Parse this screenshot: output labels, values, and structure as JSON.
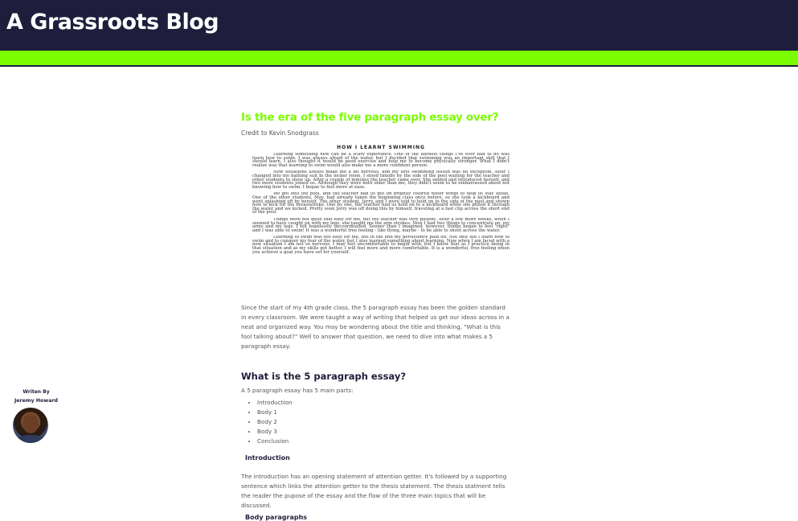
{
  "site": {
    "title": "A Grassroots Blog"
  },
  "colors": {
    "header_bg": "#1e1e3c",
    "accent": "#7cfc00",
    "text": "#555555"
  },
  "post": {
    "title": "Is the era of the five paragraph essay over?",
    "credit": "Credit to Kevin Snodgrass",
    "image": {
      "heading": "HOW I LEARNT SWIMMING",
      "paragraphs": [
        "Learning something new can be a scary experience. One of the hardest things I've ever had to do was learn how to swim. I was always afraid of the water, but I decided that swimming was an important skill that I should learn. I also thought it would be good exercise and help me to become physically stronger. What I didn't realize was that learning to swim would also make me a more confident person.",
        "New situations always make me a bit nervous, and my first swimming lesson was no exception. After I changed into my bathing suit in the locker room, I stood timidly by the side of the pool waiting for the teacher and other students to show up. After a couple of minutes the teacher came over. She smiled and introduced herself, and two more students joined us. Although they were both older than me, they didn't seem to be embarrassed about not knowing how to swim. I began to feel more at ease.",
        "We got into the pool, and the teacher had us put on brightly colored water wings to help us stay afloat. One of the other students, May, had already taken the beginning class once before, so she took a kickboard and went splashing off by herself. The other student, Jerry, and I were told to hold on to the side of the pool and shown how to kick for the breaststroke. One by one, the teacher had us hold on to a kickboard while she pulled it through the water and we kicked. Pretty soon Jerry was off doing this by himself, traveling at a fast clip across the short end of the pool.",
        "Things were not quite that easy for me, but the teacher was very patient. After a few more weeks, when I seemed to have caught on with my legs, she taught me the arm strokes. Now I had two things to concentrate on, my arms and my legs. I felt hopelessly uncoordinated. Sooner than I imagined, however, things began to feel \"right\" and I was able to swim! It was a wonderful free feeling - like flying, maybe - to be able to shoot across the water.",
        "Learning to swim was not easy for me, but in the end my persistence paid off. Not only did I learn how to swim and to conquer my fear of the water, but I also learned something about learning. Now when I am faced with a new situation I am not so nervous. I may feel uncomfortable to begin with, but I know that as I practice being in that situation and as my skills get better, I will feel more and more comfortable. It is a wonderful, free feeling when you achieve a goal you have set for yourself."
      ]
    },
    "intro_paragraph": "Since the start of my 4th grade class, the 5 paragraph essay has been the golden standard in every classroom. We were taught a way of writing that helped us get our ideas across in a neat and organized way. You may be wondering about the title and thinking, \"What is this fool talking about?\" Well to answer that question, we need to dive into what makes a 5 paragraph essay.",
    "section_heading": "What is the 5 paragraph essay?",
    "parts_intro": "A 5 paragraph essay has 5 main parts:",
    "parts": [
      "Introduction",
      "Body 1",
      "Body 2",
      "Body 3",
      "Conclusion"
    ],
    "introduction_heading": "Introduction",
    "introduction_text": "The introduction has an opening statement of attention getter. It's followed by a supporting sentence which links the attention getter to the thesis statement. The thesis statment tells the reader the pupose of the essay and the flow of the three main topics that will be discussed.",
    "body_heading": "Body paragraphs"
  },
  "author": {
    "written_by": "Writen By",
    "name": "Jeremy Howard"
  }
}
